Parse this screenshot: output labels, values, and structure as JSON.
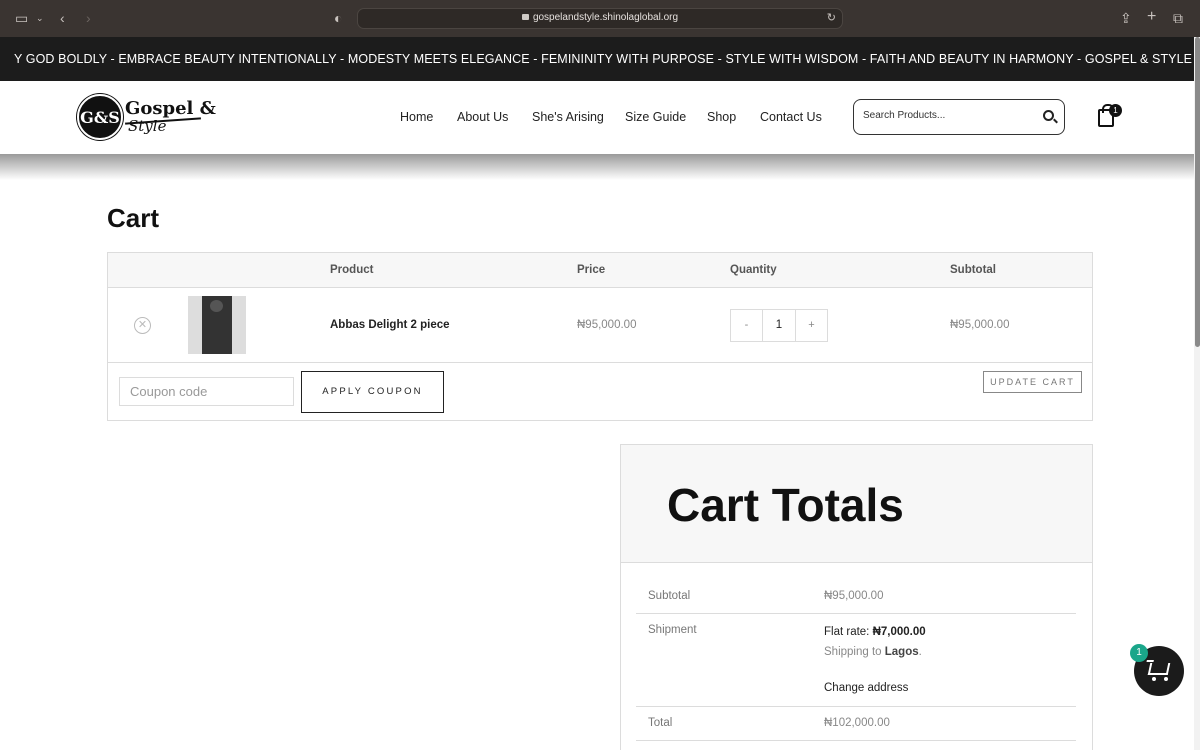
{
  "browser": {
    "url": "gospelandstyle.shinolaglobal.org"
  },
  "marquee": {
    "text": "Y GOD BOLDLY - EMBRACE BEAUTY INTENTIONALLY - MODESTY MEETS ELEGANCE - FEMININITY WITH PURPOSE - STYLE WITH WISDOM - FAITH AND BEAUTY IN HARMONY - GOSPEL & STYLE - CARRY GOD BOLDLY - EMBRA"
  },
  "header": {
    "logo_monogram": "G&S",
    "logo_text": "Gospel &",
    "logo_sub": "Style",
    "nav": [
      "Home",
      "About Us",
      "She's Arising",
      "Size Guide",
      "Shop",
      "Contact Us"
    ],
    "search_placeholder": "Search Products...",
    "cart_count": "1"
  },
  "page": {
    "title": "Cart"
  },
  "cart": {
    "columns": [
      "Product",
      "Price",
      "Quantity",
      "Subtotal"
    ],
    "items": [
      {
        "name": "Abbas Delight 2 piece",
        "price": "₦95,000.00",
        "quantity": "1",
        "subtotal": "₦95,000.00"
      }
    ],
    "qty_minus": "-",
    "qty_plus": "+",
    "coupon_placeholder": "Coupon code",
    "apply_label": "APPLY COUPON",
    "update_label": "UPDATE CART"
  },
  "totals": {
    "title": "Cart Totals",
    "subtotal_label": "Subtotal",
    "subtotal_value": "₦95,000.00",
    "shipment_label": "Shipment",
    "flat_rate_label": "Flat rate:",
    "flat_rate_value": "₦7,000.00",
    "shipping_to_label": "Shipping to",
    "shipping_to_value": "Lagos",
    "change_address": "Change address",
    "total_label": "Total",
    "total_value": "₦102,000.00"
  },
  "floating_cart": {
    "count": "1"
  },
  "colors": {
    "chrome": "#3a3431",
    "marquee_bg": "#1c1c1c",
    "badge_green": "#1aa68a"
  }
}
